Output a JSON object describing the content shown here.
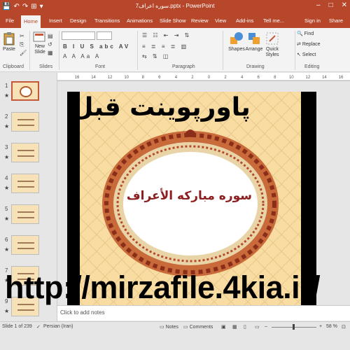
{
  "titlebar": {
    "title": "سوره اعراف7.pptx - PowerPoint",
    "qat": [
      "💾",
      "↶",
      "↷",
      "⊞",
      "▾"
    ],
    "controls": [
      "–",
      "□",
      "✕"
    ],
    "bg": "#b7472a"
  },
  "tabs": [
    "File",
    "Home",
    "Insert",
    "Design",
    "Transitions",
    "Animations",
    "Slide Show",
    "Review",
    "View",
    "Add-ins",
    "Tell me...",
    "Sign in",
    "Share"
  ],
  "ribbon": {
    "clipboard": {
      "paste": "Paste",
      "label": "Clipboard"
    },
    "slides": {
      "new_slide": "New Slide",
      "label": "Slides"
    },
    "font": {
      "label": "Font"
    },
    "paragraph": {
      "label": "Paragraph"
    },
    "drawing": {
      "shapes": "Shapes",
      "arrange": "Arrange",
      "quick_styles": "Quick Styles",
      "label": "Drawing"
    },
    "editing": {
      "find": "Find",
      "replace": "Replace",
      "select": "Select",
      "label": "Editing"
    }
  },
  "ruler": {
    "ticks": [
      "16",
      "14",
      "12",
      "10",
      "8",
      "6",
      "4",
      "2",
      "0",
      "2",
      "4",
      "6",
      "8",
      "10",
      "12",
      "14",
      "16"
    ]
  },
  "thumbnails": [
    {
      "num": "1",
      "star": "★"
    },
    {
      "num": "2",
      "star": "★"
    },
    {
      "num": "3",
      "star": "★"
    },
    {
      "num": "4",
      "star": "★"
    },
    {
      "num": "5",
      "star": "★"
    },
    {
      "num": "6",
      "star": "★"
    },
    {
      "num": "7",
      "star": "★"
    },
    {
      "num": "8",
      "star": "★"
    },
    {
      "num": "9",
      "star": "★"
    }
  ],
  "slide": {
    "title": "سوره مبارکه الأعراف",
    "title_color": "#8b1e1e",
    "bg_color": "#f8dca2"
  },
  "notes": {
    "placeholder": "Click to add notes"
  },
  "statusbar": {
    "slide_info": "Slide 1 of 239",
    "language": "Persian (Iran)",
    "notes": "Notes",
    "comments": "Comments",
    "zoom": "58 %"
  },
  "overlay": {
    "top": "پاورپوینت قبل",
    "bottom": "http://mirzafile.4kia.ir/"
  }
}
